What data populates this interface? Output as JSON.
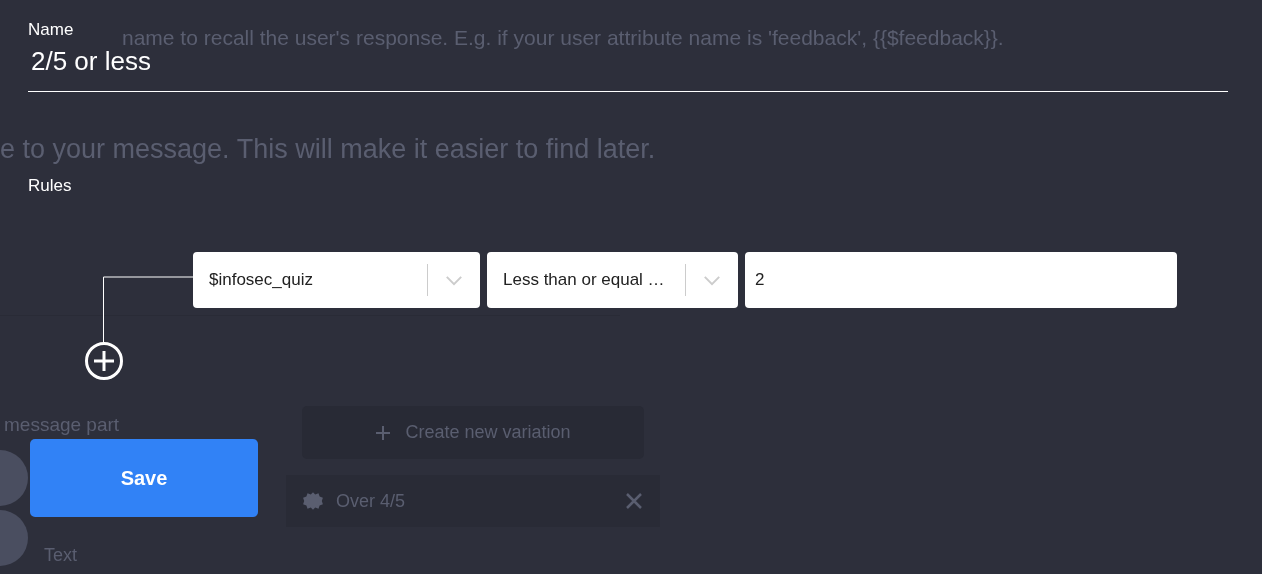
{
  "background": {
    "hint": "name to recall the user's response. E.g. if your user attribute name is 'feedback', {{$feedback}}.",
    "subtitle": "e to your message. This will make it easier to find later.",
    "section_label": "message part",
    "create_button": "Create new variation",
    "variation": {
      "label": "Over 4/5"
    },
    "item_label": "Text"
  },
  "dialog": {
    "name": {
      "label": "Name",
      "value": "2/5 or less"
    },
    "rules_label": "Rules",
    "rules": [
      {
        "attribute": "$infosec_quiz",
        "operator": "Less than or equal …",
        "value": "2"
      }
    ],
    "save_button": "Save"
  }
}
